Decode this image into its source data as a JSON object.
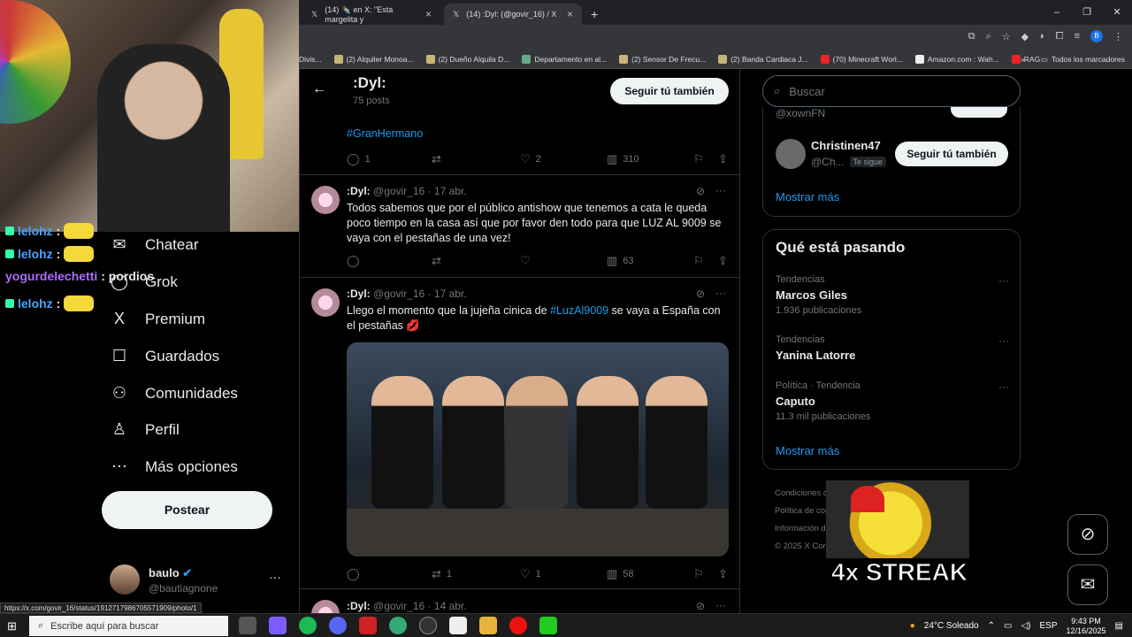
{
  "browser": {
    "tabs": [
      {
        "label": "(14) ✒️ en X: \"Esta margelita y"
      },
      {
        "label": "(14) :Dyl: (@govir_16) / X"
      }
    ],
    "bookmarks": [
      "Divis...",
      "(2) Alquiler Monoa...",
      "(2) Dueño Alquila D...",
      "Departamento en al...",
      "(2) Sensor De Frecu...",
      "(2) Banda Cardiaca J...",
      "(70) Minecraft Worl...",
      "Amazon.com : Wah...",
      "RAG"
    ],
    "bookmarks_more": "»",
    "all_bookmarks": "Todos los marcadores",
    "profile_letter": "B",
    "status_url": "https://x.com/govir_16/status/1912717986705571909/photo/1"
  },
  "stream": {
    "chat": [
      {
        "user": "lelohz",
        "text": ":"
      },
      {
        "user": "lelohz",
        "text": ":"
      },
      {
        "user": "yogurdelechetti",
        "text": ": pordios"
      },
      {
        "user": "lelohz",
        "text": ":"
      }
    ],
    "streak": "4x STREAK"
  },
  "nav": {
    "items": [
      {
        "label": "Chatear",
        "icon": "✉"
      },
      {
        "label": "Grok",
        "icon": "◯"
      },
      {
        "label": "Premium",
        "icon": "X"
      },
      {
        "label": "Guardados",
        "icon": "☐"
      },
      {
        "label": "Comunidades",
        "icon": "⚇"
      },
      {
        "label": "Perfil",
        "icon": "♙"
      },
      {
        "label": "Más opciones",
        "icon": "⋯"
      }
    ],
    "post_label": "Postear",
    "account": {
      "name": "baulo",
      "handle": "@bautiagnone",
      "more": "···"
    }
  },
  "profile": {
    "name": ":Dyl:",
    "posts": "75 posts",
    "follow_label": "Seguir tú también"
  },
  "tweets": [
    {
      "text_tag": "#GranHermano",
      "replies": "1",
      "retweets": "",
      "likes": "2",
      "views": "310"
    },
    {
      "author": ":Dyl:",
      "handle": "@govir_16",
      "date": "17 abr.",
      "text": "Todos sabemos que por el público antishow que tenemos a cata le queda poco tiempo en la casa así que por favor den todo para que LUZ AL 9009 se vaya con el pestañas de una vez!",
      "replies": "",
      "retweets": "",
      "likes": "",
      "views": "63"
    },
    {
      "author": ":Dyl:",
      "handle": "@govir_16",
      "date": "17 abr.",
      "text_a": "Llego el momento que la  jujeña cinica de ",
      "text_tag": "#LuzAl9009",
      "text_b": " se vaya a España con el pestañas 💋",
      "replies": "",
      "retweets": "1",
      "likes": "1",
      "views": "58"
    },
    {
      "author": ":Dyl:",
      "handle": "@govir_16",
      "date": "14 abr."
    }
  ],
  "sidebar": {
    "search_placeholder": "Buscar",
    "who_prev_handle": "@xownFN",
    "who": {
      "name": "Christinen47",
      "handle": "@Ch...",
      "follows_you": "Te sigue",
      "follow_label": "Seguir tú también"
    },
    "who_more": "Mostrar más",
    "trends_title": "Qué está pasando",
    "trends": [
      {
        "context": "Tendencias",
        "name": "Marcos Giles",
        "count": "1.936 publicaciones"
      },
      {
        "context": "Tendencias",
        "name": "Yanina Latorre",
        "count": ""
      },
      {
        "context": "Política · Tendencia",
        "name": "Caputo",
        "count": "11,3 mil publicaciones"
      }
    ],
    "trends_more": "Mostrar más",
    "footer": [
      "Condiciones d",
      "Política de coo",
      "Información d",
      "© 2025 X Cor"
    ]
  },
  "taskbar": {
    "search_placeholder": "Escribe aquí para buscar",
    "weather": "24°C  Soleado",
    "lang": "ESP",
    "time": "9:43 PM",
    "date": "12/16/2025"
  }
}
